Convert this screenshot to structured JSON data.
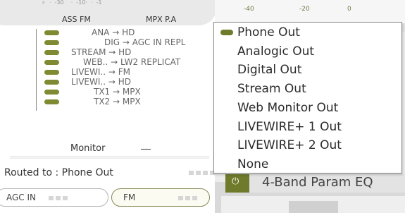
{
  "top_meter": {
    "scale_text": "ı·  ·  -30    ·  -10·  ·  -1",
    "left_label": "ASS FM",
    "right_label": "MPX P.A"
  },
  "routes": [
    {
      "label": "ANA → HD"
    },
    {
      "label": "DIG → AGC IN REPL"
    },
    {
      "label": "STREAM → HD"
    },
    {
      "label": "WEB.. → LW2 REPLICAT"
    },
    {
      "label": "LIVEWI.. → FM"
    },
    {
      "label": "LIVEWI.. → HD"
    },
    {
      "label": "TX1 → MPX"
    },
    {
      "label": "TX2 → MPX"
    }
  ],
  "monitor": {
    "title": "Monitor",
    "routed_label": "Routed to : Phone Out"
  },
  "bottom_buttons": {
    "agc_in": "AGC IN",
    "fm": "FM"
  },
  "meter_scale": [
    "-40",
    "-20",
    "0"
  ],
  "dropdown": {
    "selected_index": 0,
    "items": [
      "Phone Out",
      "Analogic Out",
      "Digital Out",
      "Stream Out",
      "Web Monitor Out",
      "LIVEWIRE+ 1 Out",
      "LIVEWIRE+ 2 Out",
      "None"
    ]
  },
  "eq": {
    "power_icon": "power-icon",
    "label": "4-Band Param EQ"
  },
  "colors": {
    "accent": "#6f7a2a",
    "pill": "#7f8a32"
  }
}
